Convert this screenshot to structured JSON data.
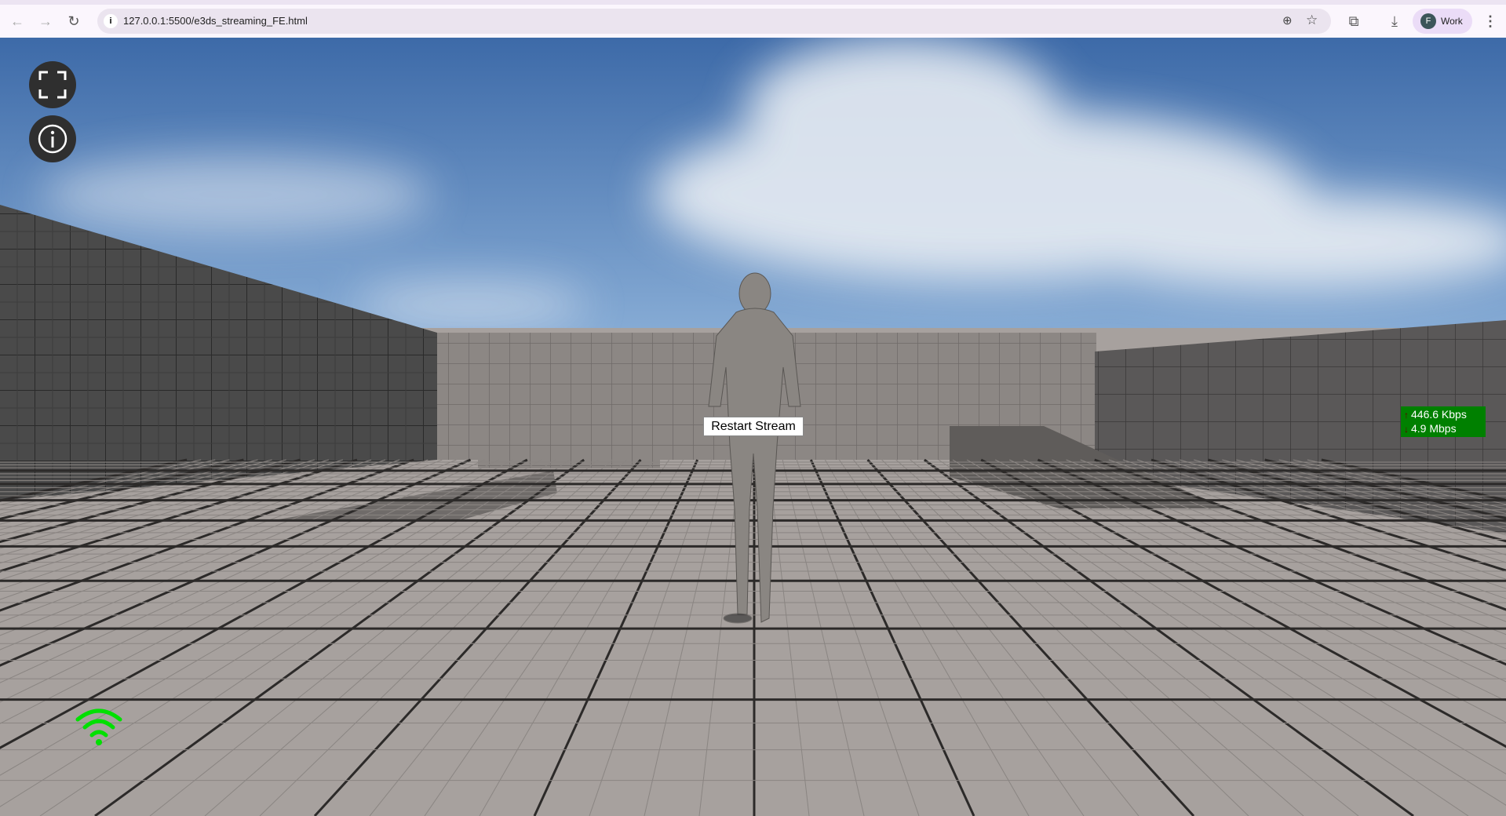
{
  "browser": {
    "url": "127.0.0.1:5500/e3ds_streaming_FE.html",
    "profile_initial": "F",
    "profile_label": "Work",
    "icons": [
      "back-icon",
      "forward-icon",
      "reload-icon",
      "site-info-icon",
      "zoom-icon",
      "bookmark-star-icon",
      "extensions-icon",
      "download-icon",
      "menu-icon"
    ]
  },
  "stream": {
    "restart_label": "Restart Stream",
    "upload_rate": "446.6 Kbps",
    "download_rate": "4.9 Mbps",
    "connection_icon": "wifi-icon",
    "connection_color": "#00e000",
    "stats_bg_color": "#008000"
  },
  "controls": {
    "fullscreen_icon": "fullscreen-icon",
    "info_icon": "info-icon"
  }
}
